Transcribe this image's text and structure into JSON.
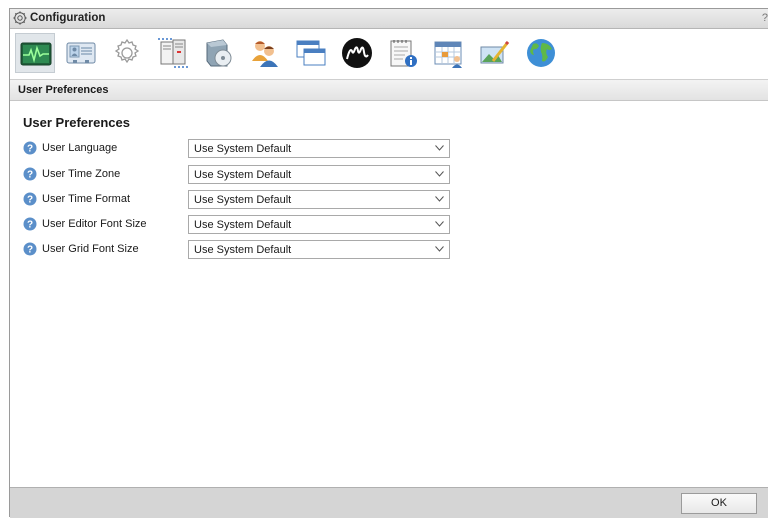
{
  "window": {
    "title": "Configuration",
    "help_glyph": "?"
  },
  "toolbar": {
    "buttons": [
      {
        "icon": "system-monitor-icon",
        "selected": true
      },
      {
        "icon": "user-card-icon",
        "selected": false
      },
      {
        "icon": "gear-icon",
        "selected": false
      },
      {
        "icon": "server-icon",
        "selected": false
      },
      {
        "icon": "software-box-icon",
        "selected": false
      },
      {
        "icon": "users-icon",
        "selected": false
      },
      {
        "icon": "windows-icon",
        "selected": false
      },
      {
        "icon": "m-logo-icon",
        "selected": false
      },
      {
        "icon": "notepad-info-icon",
        "selected": false
      },
      {
        "icon": "calendar-user-icon",
        "selected": false
      },
      {
        "icon": "image-edit-icon",
        "selected": false
      },
      {
        "icon": "globe-icon",
        "selected": false
      }
    ]
  },
  "section": {
    "header": "User Preferences"
  },
  "form": {
    "title": "User Preferences",
    "rows": [
      {
        "label": "User Language",
        "value": "Use System Default"
      },
      {
        "label": "User Time Zone",
        "value": "Use System Default"
      },
      {
        "label": "User Time Format",
        "value": "Use System Default"
      },
      {
        "label": "User Editor Font Size",
        "value": "Use System Default"
      },
      {
        "label": "User Grid Font Size",
        "value": "Use System Default"
      }
    ]
  },
  "footer": {
    "ok_label": "OK"
  },
  "colors": {
    "help_icon": "#5b8fc9",
    "selected_tab_bg": "#e1e6ea"
  }
}
